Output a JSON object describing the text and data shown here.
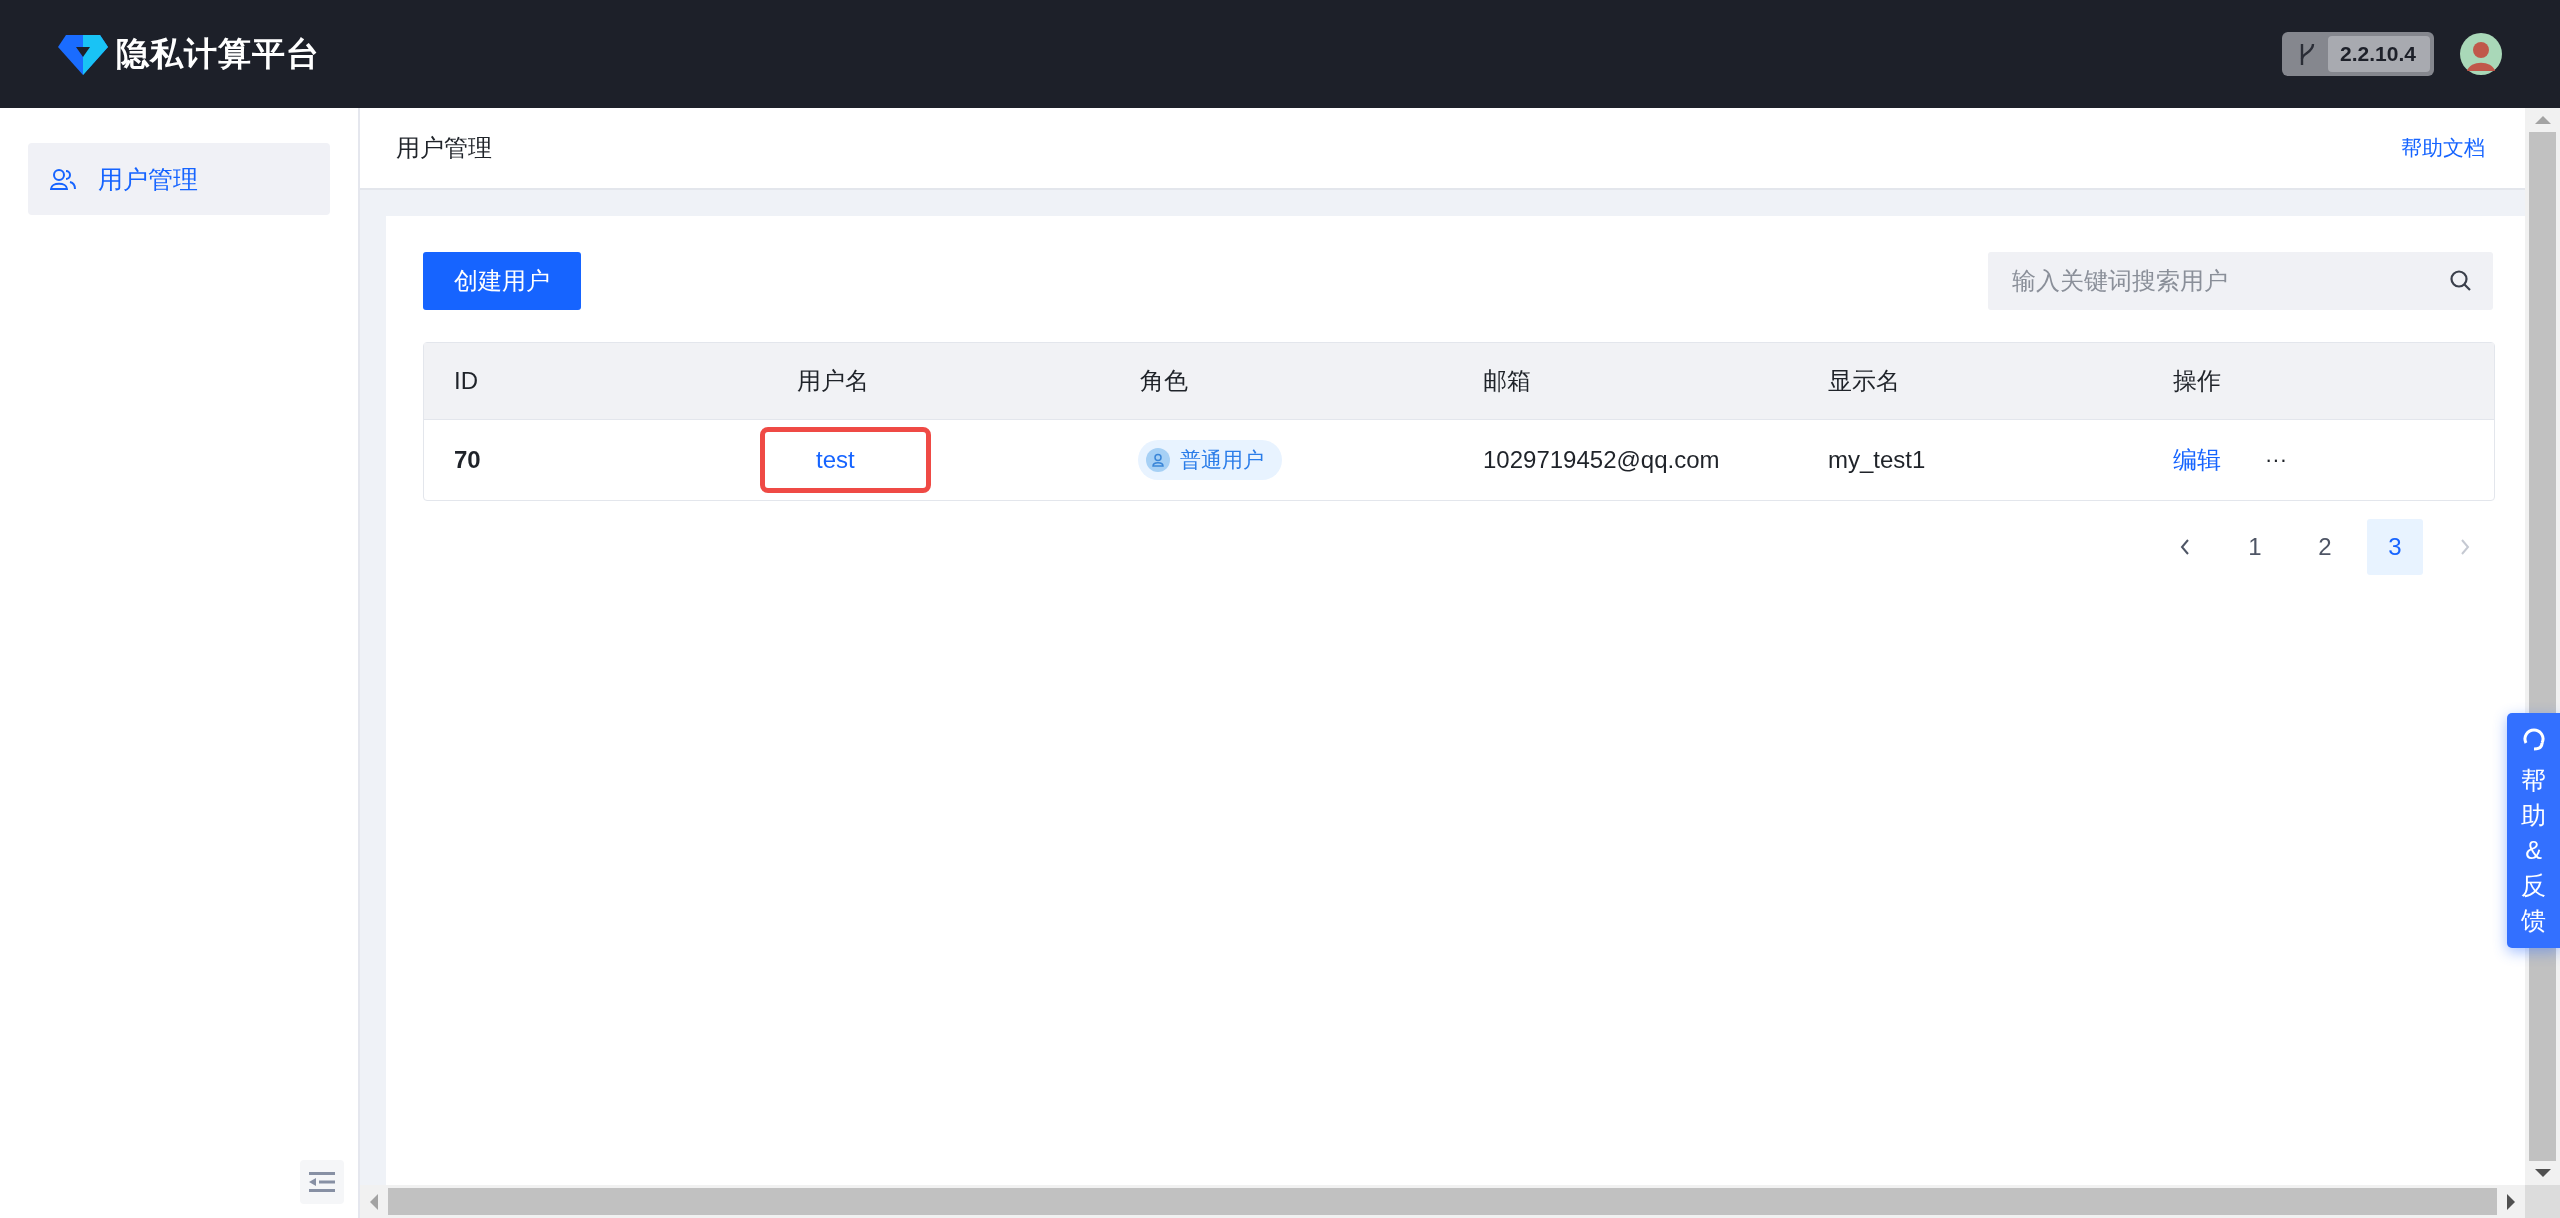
{
  "header": {
    "logo_text": "隐私计算平台",
    "version": "2.2.10.4"
  },
  "sidebar": {
    "items": [
      {
        "label": "用户管理",
        "selected": true
      }
    ]
  },
  "page": {
    "title": "用户管理",
    "help_link": "帮助文档"
  },
  "toolbar": {
    "create_button": "创建用户",
    "search": {
      "placeholder": "输入关键词搜索用户"
    }
  },
  "table": {
    "columns": [
      "ID",
      "用户名",
      "角色",
      "邮箱",
      "显示名",
      "操作"
    ],
    "rows": [
      {
        "id": "70",
        "username": "test",
        "username_highlighted": true,
        "role": "普通用户",
        "email": "1029719452@qq.com",
        "display_name": "my_test1",
        "edit": "编辑",
        "more": "···"
      }
    ]
  },
  "pagination": {
    "prev_disabled": false,
    "next_disabled": true,
    "pages": [
      {
        "label": "1",
        "selected": false
      },
      {
        "label": "2",
        "selected": false
      },
      {
        "label": "3",
        "selected": true
      }
    ]
  },
  "help_button": {
    "label": "帮助&反馈"
  }
}
